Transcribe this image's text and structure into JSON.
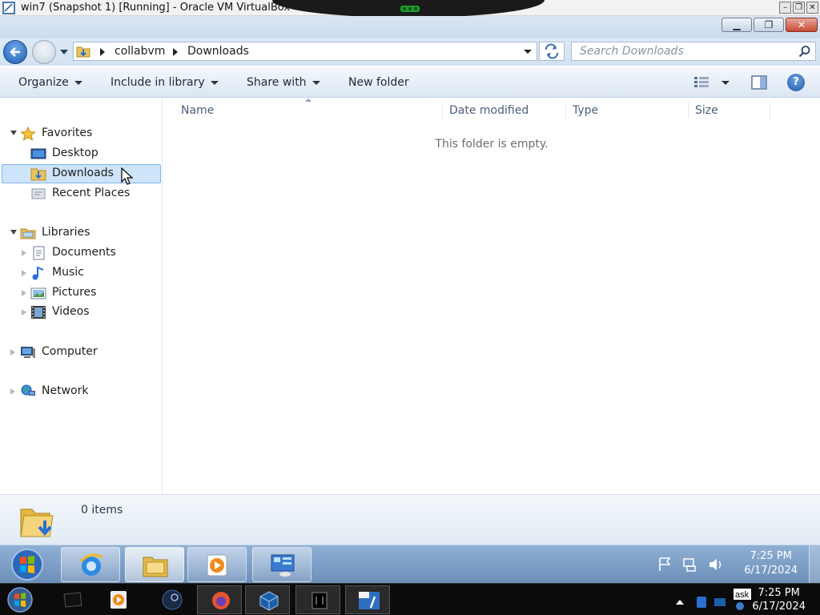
{
  "host_window": {
    "title": "win7 (Snapshot 1) [Running] - Oracle VM VirtualBox",
    "controls": [
      "minimize",
      "restore",
      "close"
    ]
  },
  "explorer": {
    "address": {
      "breadcrumbs": [
        "collabvm",
        "Downloads"
      ]
    },
    "search": {
      "placeholder": "Search Downloads"
    },
    "commands": {
      "organize": "Organize",
      "include_in_library": "Include in library",
      "share_with": "Share with",
      "new_folder": "New folder"
    },
    "nav": {
      "favorites": "Favorites",
      "desktop": "Desktop",
      "downloads": "Downloads",
      "recent_places": "Recent Places",
      "libraries": "Libraries",
      "documents": "Documents",
      "music": "Music",
      "pictures": "Pictures",
      "videos": "Videos",
      "computer": "Computer",
      "network": "Network",
      "selected": "Downloads"
    },
    "columns": [
      "Name",
      "Date modified",
      "Type",
      "Size"
    ],
    "empty_message": "This folder is empty.",
    "details": {
      "item_count": "0 items"
    }
  },
  "guest_taskbar": {
    "buttons": [
      "start-orb",
      "internet-explorer",
      "windows-explorer",
      "media-player",
      "control-panel"
    ],
    "active": "windows-explorer",
    "clock": {
      "time": "7:25 PM",
      "date": "6/17/2024"
    }
  },
  "host_taskbar": {
    "apps": [
      "start",
      "terminal",
      "media-player",
      "steam",
      "firefox",
      "virtualbox",
      "task-window",
      "win7-vm"
    ],
    "tray_badge": "ask",
    "clock": {
      "time": "7:25 PM",
      "date": "6/17/2024"
    }
  },
  "colors": {
    "selection": "#cde4fa",
    "selection_border": "#7fb5e9",
    "taskbar": "#7a9cc6",
    "host_taskbar": "#0b0b0b"
  }
}
